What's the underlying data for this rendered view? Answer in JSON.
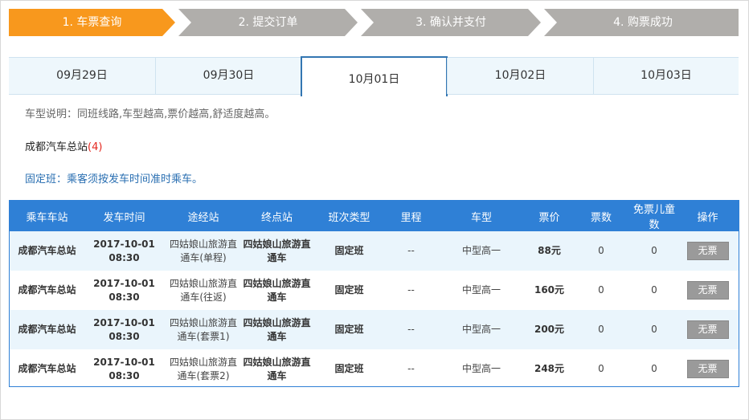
{
  "steps": [
    {
      "label": "1. 车票查询"
    },
    {
      "label": "2. 提交订单"
    },
    {
      "label": "3. 确认并支付"
    },
    {
      "label": "4. 购票成功"
    }
  ],
  "dates": [
    {
      "label": "09月29日"
    },
    {
      "label": "09月30日"
    },
    {
      "label": "10月01日"
    },
    {
      "label": "10月02日"
    },
    {
      "label": "10月03日"
    }
  ],
  "info": {
    "vehicle_note": "车型说明：同班线路,车型越高,票价越高,舒适度越高。",
    "station_name": "成都汽车总站",
    "station_count": "(4)",
    "fixed_note": "固定班：乘客须按发车时间准时乘车。"
  },
  "table": {
    "headers": [
      "乘车车站",
      "发车时间",
      "途经站",
      "终点站",
      "班次类型",
      "里程",
      "车型",
      "票价",
      "票数",
      "免票儿童数",
      "操作"
    ],
    "rows": [
      {
        "station": "成都汽车总站",
        "date": "2017-10-01",
        "time": "08:30",
        "via1": "四姑娘山旅游直",
        "via2": "通车(单程)",
        "dest1": "四姑娘山旅游直",
        "dest2": "通车",
        "type": "固定班",
        "distance": "--",
        "vehicle": "中型高一",
        "price": "88元",
        "tickets": "0",
        "free": "0",
        "action": "无票"
      },
      {
        "station": "成都汽车总站",
        "date": "2017-10-01",
        "time": "08:30",
        "via1": "四姑娘山旅游直",
        "via2": "通车(往返)",
        "dest1": "四姑娘山旅游直",
        "dest2": "通车",
        "type": "固定班",
        "distance": "--",
        "vehicle": "中型高一",
        "price": "160元",
        "tickets": "0",
        "free": "0",
        "action": "无票"
      },
      {
        "station": "成都汽车总站",
        "date": "2017-10-01",
        "time": "08:30",
        "via1": "四姑娘山旅游直",
        "via2": "通车(套票1)",
        "dest1": "四姑娘山旅游直",
        "dest2": "通车",
        "type": "固定班",
        "distance": "--",
        "vehicle": "中型高一",
        "price": "200元",
        "tickets": "0",
        "free": "0",
        "action": "无票"
      },
      {
        "station": "成都汽车总站",
        "date": "2017-10-01",
        "time": "08:30",
        "via1": "四姑娘山旅游直",
        "via2": "通车(套票2)",
        "dest1": "四姑娘山旅游直",
        "dest2": "通车",
        "type": "固定班",
        "distance": "--",
        "vehicle": "中型高一",
        "price": "248元",
        "tickets": "0",
        "free": "0",
        "action": "无票"
      }
    ]
  },
  "colors": {
    "active_step": "#f8981d",
    "inactive_step": "#b0aeab",
    "header_blue": "#2f80d6",
    "count_red": "#e4281f"
  }
}
